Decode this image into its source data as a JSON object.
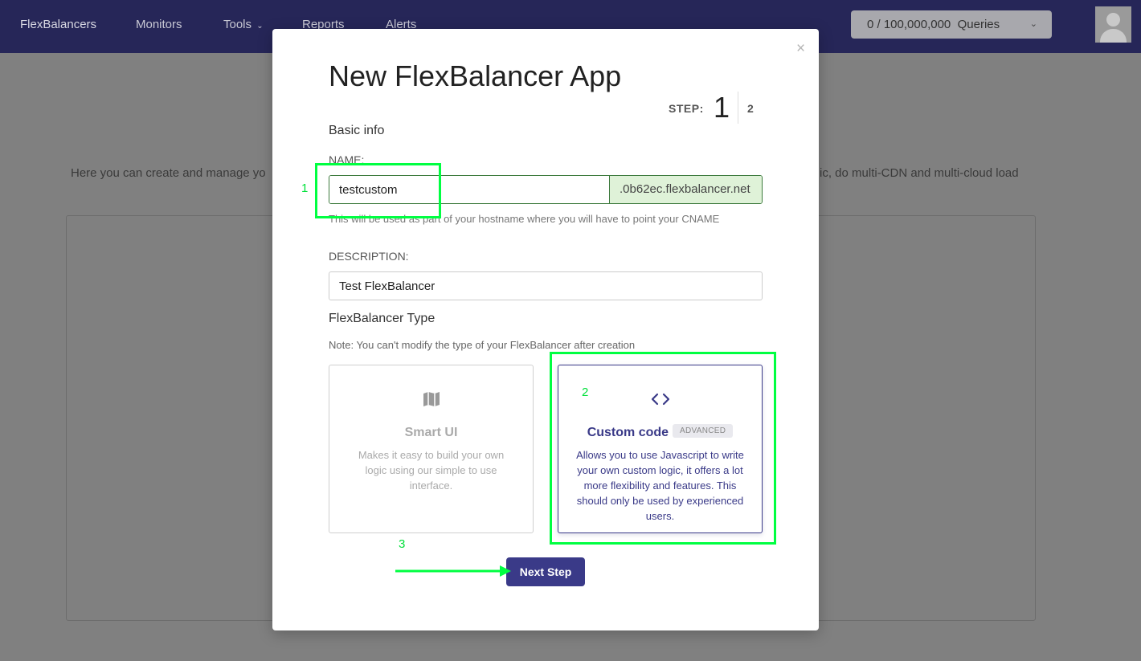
{
  "nav": {
    "brand": "FlexBalancers",
    "items": [
      {
        "label": "Monitors"
      },
      {
        "label": "Tools"
      },
      {
        "label": "Reports"
      },
      {
        "label": "Alerts"
      }
    ],
    "queries": "0 / 100,000,000  Queries"
  },
  "background": {
    "intro_left": "Here you can create and manage yo",
    "intro_right": "ic, do multi-CDN and multi-cloud load"
  },
  "modal": {
    "title": "New FlexBalancer App",
    "close": "×",
    "step": {
      "label": "STEP:",
      "current": "1",
      "next": "2"
    },
    "basic_info": "Basic info",
    "name_label": "NAME:",
    "name_value": "testcustom",
    "name_suffix": ".0b62ec.flexbalancer.net",
    "name_help": "This will be used as part of your hostname where you will have to point your CNAME",
    "description_label": "DESCRIPTION:",
    "description_value": "Test FlexBalancer",
    "type_heading": "FlexBalancer Type",
    "type_note": "Note: You can't modify the type of your FlexBalancer after creation",
    "types": {
      "smart": {
        "title": "Smart UI",
        "icon": "map-icon",
        "description": "Makes it easy to build your own logic using our simple to use interface."
      },
      "custom": {
        "title": "Custom code",
        "badge": "ADVANCED",
        "icon": "code-icon",
        "description": "Allows you to use Javascript to write your own custom logic, it offers a lot more flexibility and features. This should only be used by experienced users."
      }
    },
    "next_button": "Next Step"
  },
  "annotations": [
    "1",
    "2",
    "3"
  ],
  "colors": {
    "nav_bg": "#262658",
    "accent": "#3a3a88",
    "annotation": "#00ff41",
    "suffix_bg": "#dff2d8"
  }
}
